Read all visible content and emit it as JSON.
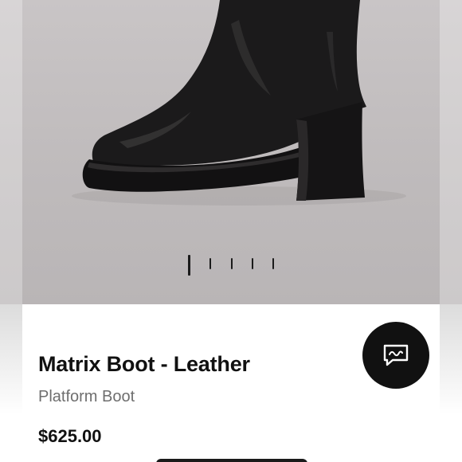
{
  "product": {
    "name": "Matrix Boot - Leather",
    "subtitle": "Platform Boot",
    "price": "$625.00"
  },
  "carousel": {
    "image_count": 5,
    "active_index": 0
  },
  "icons": {
    "chat": "chat-message-icon"
  },
  "colors": {
    "accent": "#111111",
    "background": "#c4c0c1"
  }
}
